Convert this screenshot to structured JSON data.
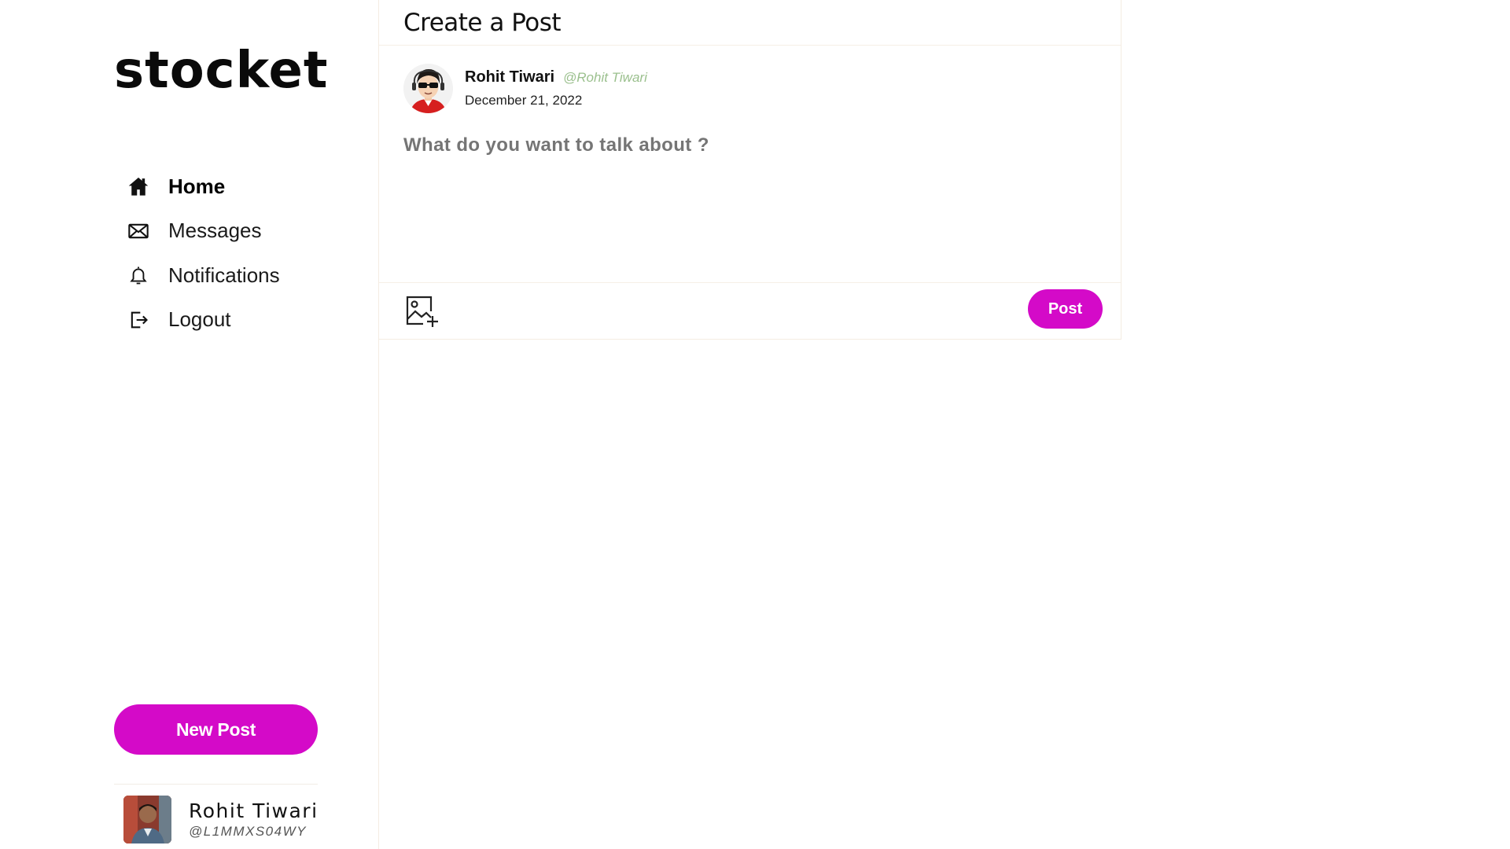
{
  "app": {
    "logo_text": "stocket",
    "accent_color": "#d40ac8"
  },
  "sidebar": {
    "items": [
      {
        "label": "Home",
        "icon": "home-icon",
        "active": true
      },
      {
        "label": "Messages",
        "icon": "envelope-icon",
        "active": false
      },
      {
        "label": "Notifications",
        "icon": "bell-icon",
        "active": false
      },
      {
        "label": "Logout",
        "icon": "logout-icon",
        "active": false
      }
    ],
    "new_post_label": "New Post",
    "profile": {
      "name": "Rohit Tiwari",
      "handle": "@L1MMXS04WY"
    }
  },
  "main": {
    "title": "Create a Post",
    "composer": {
      "author_name": "Rohit Tiwari",
      "author_handle": "@Rohit Tiwari",
      "date": "December 21, 2022",
      "placeholder": "What do you want to talk about ?",
      "value": "",
      "post_label": "Post"
    }
  }
}
